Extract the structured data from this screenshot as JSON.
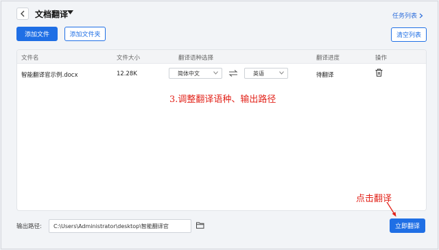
{
  "header": {
    "title": "文档翻译",
    "task_list": "任务列表"
  },
  "toolbar": {
    "add_file": "添加文件",
    "add_folder": "添加文件夹",
    "clear_list": "清空列表"
  },
  "table": {
    "columns": [
      "文件名",
      "文件大小",
      "翻译语种选择",
      "翻译进度",
      "操作"
    ],
    "rows": [
      {
        "name": "智能翻译官示例.docx",
        "size": "12.28K",
        "source_lang": "简体中文",
        "target_lang": "英语",
        "progress": "待翻译"
      }
    ]
  },
  "annotations": {
    "step3": "3.调整翻译语种、输出路径",
    "click": "点击翻译"
  },
  "footer": {
    "output_label": "输出路径:",
    "output_path": "C:\\Users\\Administrator\\desktop\\智能翻译官",
    "translate_button": "立即翻译"
  },
  "colors": {
    "accent": "#1f6fe5",
    "annotation": "#e2231a"
  }
}
